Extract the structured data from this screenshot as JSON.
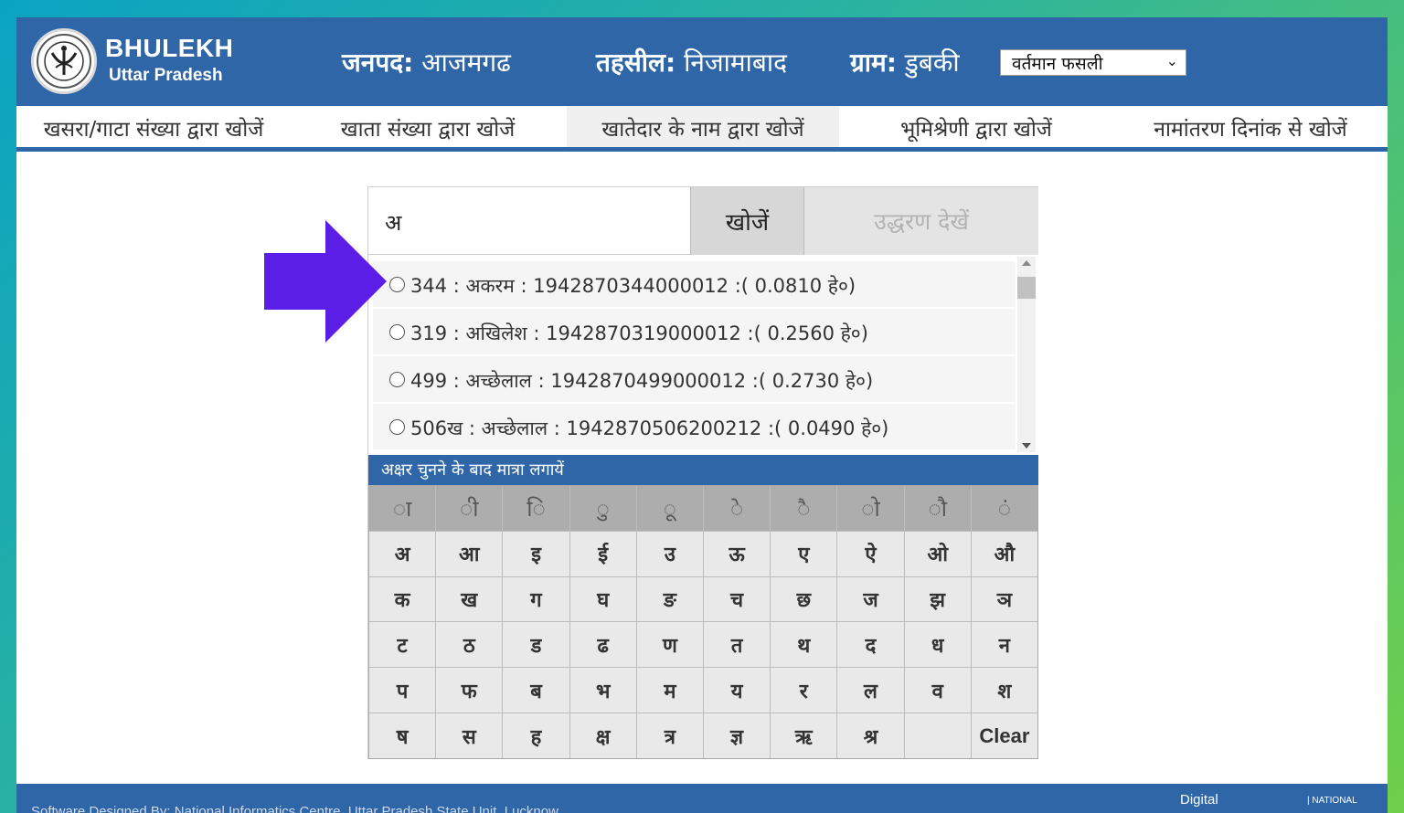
{
  "header": {
    "brand_title": "BHULEKH",
    "brand_sub": "Uttar Pradesh",
    "janpad_label": "जनपद:",
    "janpad_value": "आजमगढ",
    "tehsil_label": "तहसील:",
    "tehsil_value": "निजामाबाद",
    "gram_label": "ग्राम:",
    "gram_value": "डुबकी",
    "fasli_selected": "वर्तमान फसली"
  },
  "nav": {
    "items": [
      {
        "label": "खसरा/गाटा संख्या द्वारा खोजें"
      },
      {
        "label": "खाता संख्या द्वारा खोजें"
      },
      {
        "label": "खातेदार के नाम द्वारा खोजें"
      },
      {
        "label": "भूमिश्रेणी द्वारा खोजें"
      },
      {
        "label": "नामांतरण दिनांक से खोजें"
      }
    ]
  },
  "search": {
    "input_value": "अ",
    "search_button": "खोजें",
    "view_button": "उद्धरण देखें"
  },
  "results": [
    {
      "text": "344 : अकरम : 1942870344000012 :( 0.0810 हे०)"
    },
    {
      "text": "319 : अखिलेश : 1942870319000012 :( 0.2560 हे०)"
    },
    {
      "text": "499 : अच्छेलाल : 1942870499000012 :( 0.2730 हे०)"
    },
    {
      "text": "506ख : अच्छेलाल : 1942870506200212 :( 0.0490 हे०)"
    }
  ],
  "keyboard": {
    "hint": "अक्षर चुनने के बाद मात्रा लगायें",
    "keys": [
      "ा",
      "ी",
      "ि",
      "ु",
      "ू",
      "े",
      "ै",
      "ो",
      "ौ",
      "ं",
      "अ",
      "आ",
      "इ",
      "ई",
      "उ",
      "ऊ",
      "ए",
      "ऐ",
      "ओ",
      "औ",
      "क",
      "ख",
      "ग",
      "घ",
      "ङ",
      "च",
      "छ",
      "ज",
      "झ",
      "ञ",
      "ट",
      "ठ",
      "ड",
      "ढ",
      "ण",
      "त",
      "थ",
      "द",
      "ध",
      "न",
      "प",
      "फ",
      "ब",
      "भ",
      "म",
      "य",
      "र",
      "ल",
      "व",
      "श",
      "ष",
      "स",
      "ह",
      "क्ष",
      "त्र",
      "ज्ञ",
      "ऋ",
      "श्र",
      "",
      "Clear"
    ]
  },
  "footer": {
    "text": "Software Designed By: National Informatics Centre, Uttar Pradesh State Unit, Lucknow",
    "digital": "Digital",
    "nic": "| NATIONAL"
  },
  "colors": {
    "primary": "#2f66a7",
    "arrow": "#5a1ee6"
  }
}
